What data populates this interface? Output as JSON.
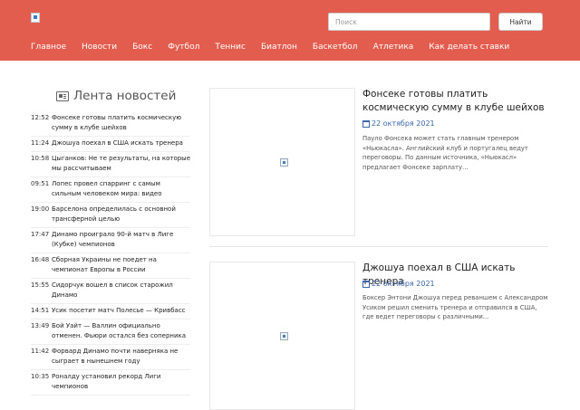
{
  "header": {
    "search_placeholder": "Поиск",
    "search_button": "Найти",
    "nav": [
      "Главное",
      "Новости",
      "Бокс",
      "Футбол",
      "Теннис",
      "Биатлон",
      "Баскетбол",
      "Атлетика",
      "Как делать ставки"
    ]
  },
  "feed": {
    "title": "Лента новостей",
    "items": [
      {
        "time": "12:52",
        "headline": "Фонсеке готовы платить космическую сумму в клубе шейхов"
      },
      {
        "time": "11:24",
        "headline": "Джошуа поехал в США искать тренера"
      },
      {
        "time": "10:58",
        "headline": "Цыганков: Не те результаты, на которые мы рассчитываем"
      },
      {
        "time": "09:51",
        "headline": "Лопес провел спарринг с самым сильным человеком мира: видео"
      },
      {
        "time": "19:00",
        "headline": "Барселона определилась с основной трансферной целью"
      },
      {
        "time": "17:47",
        "headline": "Динамо проиграло 90-й матч в Лиге (Кубке) чемпионов"
      },
      {
        "time": "16:48",
        "headline": "Сборная Украины не поедет на чемпионат Европы в России"
      },
      {
        "time": "15:55",
        "headline": "Сидорчук вошел в список старожил Динамо"
      },
      {
        "time": "14:51",
        "headline": "Усик посетит матч Полесье — Кривбасс"
      },
      {
        "time": "13:49",
        "headline": "Бой Уайт — Валлин официально отменен. Фьюри остался без соперника"
      },
      {
        "time": "11:42",
        "headline": "Форвард Динамо почти наверняка не сыграет в нынешнем году"
      },
      {
        "time": "10:35",
        "headline": "Роналду установил рекорд Лиги чемпионов"
      }
    ]
  },
  "articles": [
    {
      "title": "Фонсеке готовы платить космическую сумму в клубе шейхов",
      "date": "22 октября 2021",
      "excerpt": "Пауло Фонсека может стать главным тренером «Ньюкасла». Английский клуб и португалец ведут переговоры. По данным источника, «Ньюкасл» предлагает Фонсеке зарплату..."
    },
    {
      "title": "Джошуа поехал в США искать тренера",
      "date": "22 октября 2021",
      "excerpt": "Боксер Энтони Джошуа перед реваншем с Александром Усиком решил сменить тренера и отправился в США, где ведет переговоры с различными..."
    }
  ]
}
